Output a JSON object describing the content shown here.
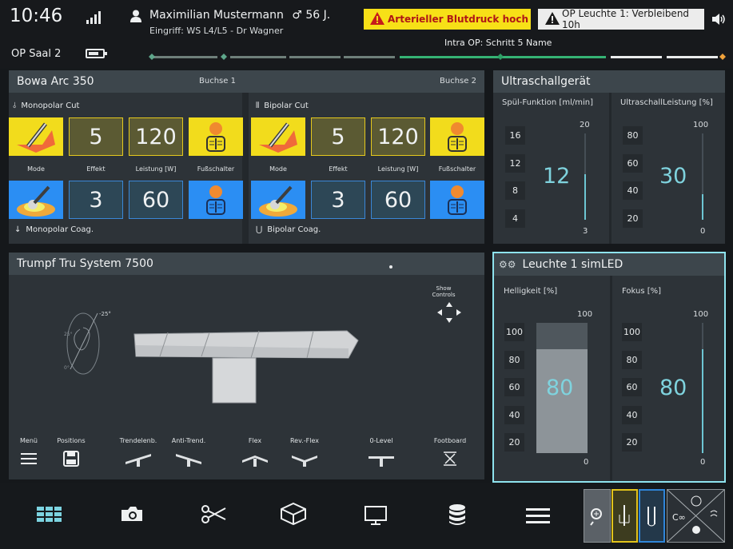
{
  "header": {
    "time": "10:46",
    "patient_name": "Maximilian Mustermann",
    "patient_age": "56 J.",
    "procedure": "Eingriff: WS L4/L5 - Dr Wagner",
    "room": "OP Saal 2",
    "step": "Intra OP: Schritt 5 Name",
    "alarm": "Arterieller Blutdruck hoch",
    "info": "OP Leuchte 1: Verbleibend 10h"
  },
  "bowa": {
    "title": "Bowa Arc 350",
    "socket1": "Buchse 1",
    "socket2": "Buchse 2",
    "left": {
      "cut_label": "Monopolar Cut",
      "coag_label": "Monopolar Coag.",
      "cut_effect": "5",
      "cut_power": "120",
      "coag_effect": "3",
      "coag_power": "60"
    },
    "right": {
      "cut_label": "Bipolar Cut",
      "coag_label": "Bipolar Coag.",
      "cut_effect": "5",
      "cut_power": "120",
      "coag_effect": "3",
      "coag_power": "60"
    },
    "labels": {
      "mode": "Mode",
      "effect": "Effekt",
      "power": "Leistung [W]",
      "footswitch": "Fußschalter"
    }
  },
  "ultrasound": {
    "title": "Ultraschallgerät",
    "rinse": {
      "label": "Spül-Funktion [ml/min]",
      "max": "20",
      "min": "3",
      "value": "12",
      "steps": [
        "16",
        "12",
        "8",
        "4"
      ],
      "level": 0.53
    },
    "power": {
      "label": "UltraschallLeistung [%]",
      "max": "100",
      "min": "0",
      "value": "30",
      "steps": [
        "80",
        "60",
        "40",
        "20"
      ],
      "level": 0.3
    }
  },
  "table": {
    "title": "Trumpf Tru System 7500",
    "show_controls": "Show Controls",
    "tilt": "-25°",
    "controls": [
      "Menü",
      "Positions",
      "Trendelenb.",
      "Anti-Trend.",
      "Flex",
      "Rev.-Flex",
      "0-Level",
      "Footboard"
    ]
  },
  "lamp": {
    "title": "Leuchte 1 simLED",
    "brightness": {
      "label": "Helligkeit [%]",
      "max": "100",
      "min": "0",
      "value": "80",
      "steps": [
        "100",
        "80",
        "60",
        "40",
        "20"
      ],
      "level": 0.8
    },
    "focus": {
      "label": "Fokus [%]",
      "max": "100",
      "min": "0",
      "value": "80",
      "steps": [
        "100",
        "80",
        "60",
        "40",
        "20"
      ],
      "level": 0.8
    }
  },
  "nav": {
    "icons": [
      "dashboard-icon",
      "camera-icon",
      "scissors-icon",
      "model-icon",
      "monitor-icon",
      "database-icon",
      "menu-icon"
    ]
  }
}
